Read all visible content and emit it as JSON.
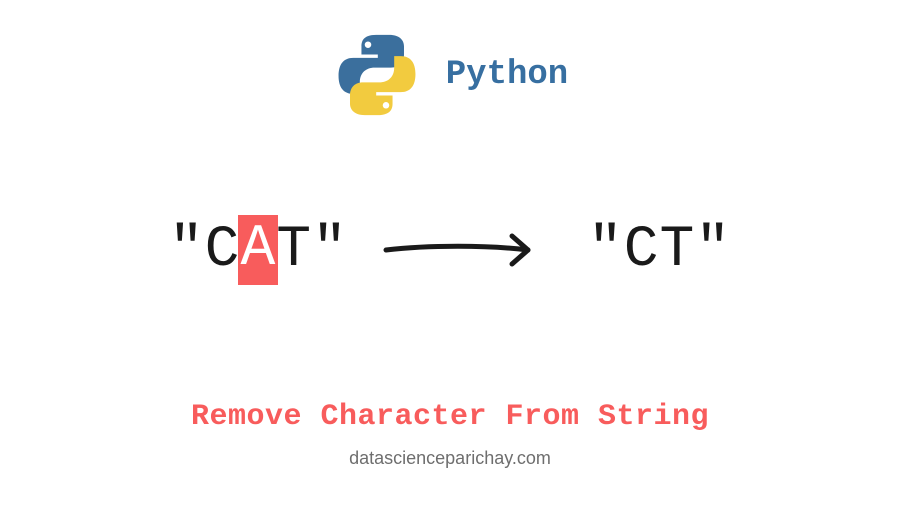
{
  "header": {
    "language": "Python",
    "logo_name": "python-logo-icon"
  },
  "diagram": {
    "input": {
      "quote_open": "\"",
      "before": "C",
      "highlight": "A",
      "after": "T",
      "quote_close": "\""
    },
    "arrow_name": "arrow-right-icon",
    "output": "\"CT\""
  },
  "caption": "Remove Character From String",
  "site": "datascienceparichay.com",
  "colors": {
    "accent_blue": "#376fa1",
    "accent_yellow": "#f0c93f",
    "highlight_red": "#f85c5c",
    "text_dark": "#1a1a1a",
    "text_muted": "#6e6e6e"
  }
}
